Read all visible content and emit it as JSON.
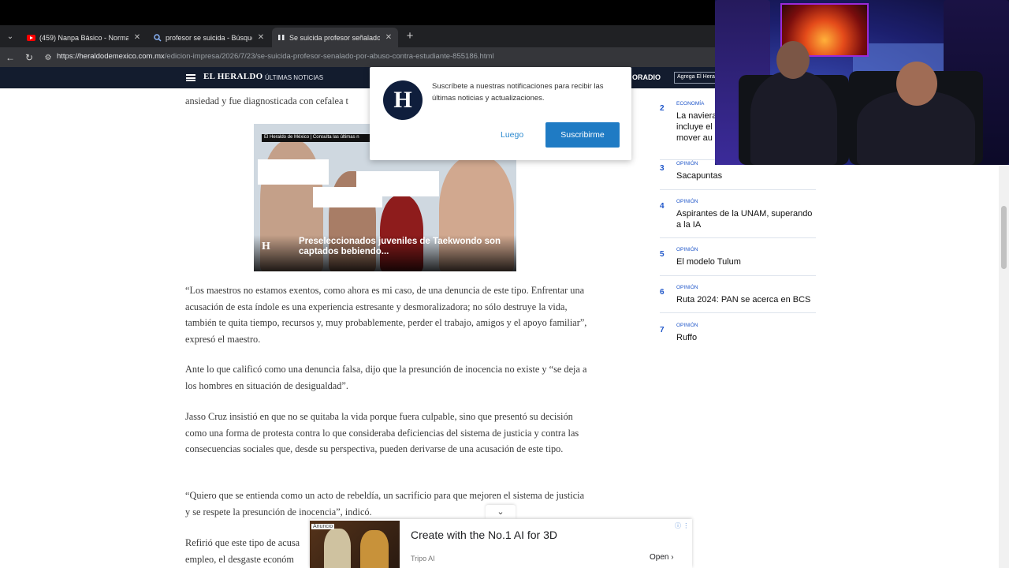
{
  "browser": {
    "tabs": [
      {
        "label": "(459) Nanpa Básico - Normal (Vi...",
        "favicon": "youtube-icon",
        "active": false
      },
      {
        "label": "profesor se suicida - Búsqueda",
        "favicon": "search-icon",
        "active": false
      },
      {
        "label": "Se suicida profesor señalado por a...",
        "favicon": "pause-icon",
        "active": true
      }
    ],
    "new_tab": "+",
    "url_host": "https://heraldodemexico.com.mx",
    "url_path": "/edicion-impresa/2026/7/23/se-suicida-profesor-senalado-por-abuso-contra-estudiante-855186.html"
  },
  "site_header": {
    "logo": "EL HERALDO",
    "ultimas": "ÚLTIMAS NOTICIAS",
    "radio": "ORADIO",
    "agrega": "Agrega El Hera"
  },
  "article": {
    "fragment_top": "ansiedad y fue diagnosticada con cefalea t",
    "paragraphs": [
      "“Los maestros no estamos exentos, como ahora es mi caso, de una denuncia de este tipo. Enfrentar una acusación de esta índole es una experiencia estresante y desmoralizadora; no sólo destruye la vida, también te quita tiempo, recursos y, muy probablemente, perder el trabajo, amigos y el apoyo familiar”, expresó el maestro.",
      "Ante lo que calificó como una denuncia falsa, dijo que la presunción de inocencia no existe y “se deja a los hombres en situación de desigualdad”.",
      "Jasso Cruz insistió en que no se quitaba la vida porque fuera culpable, sino que presentó su decisión como una forma de protesta contra lo que consideraba deficiencias del sistema de justicia y contra las consecuencias sociales que, desde su perspectiva, pueden derivarse de una acusación de este tipo.",
      "“Quiero que se entienda como un acto de rebeldía, un sacrificio para que mejoren el sistema de justicia y se respete la presunción de inocencia”, indicó.",
      "Refirió que este tipo de acusa empleo, el desgaste económ"
    ]
  },
  "video": {
    "topbar": "El Heraldo de México | Consulta las últimas n",
    "logo_letter": "H",
    "caption": "Preseleccionados juveniles de Taekwondo son captados bebiendo..."
  },
  "trending": [
    {
      "num": "2",
      "category": "ECONOMÍA",
      "title": "La naviera incluye el mover au"
    },
    {
      "num": "3",
      "category": "OPINIÓN",
      "title": "Sacapuntas"
    },
    {
      "num": "4",
      "category": "OPINIÓN",
      "title": "Aspirantes de la UNAM, superando a la IA"
    },
    {
      "num": "5",
      "category": "OPINIÓN",
      "title": "El modelo Tulum"
    },
    {
      "num": "6",
      "category": "OPINIÓN",
      "title": "Ruta 2024: PAN se acerca en BCS"
    },
    {
      "num": "7",
      "category": "OPINIÓN",
      "title": "Ruffo"
    }
  ],
  "notification": {
    "logo_letter": "H",
    "message": "Suscríbete a nuestras notificaciones para recibir las últimas noticias y actualizaciones.",
    "later": "Luego",
    "subscribe": "Suscribirme"
  },
  "ad": {
    "badge": "Anuncio",
    "title": "Create with the No.1 AI for 3D",
    "source": "Tripo AI",
    "open": "Open",
    "collapse": "⌄"
  },
  "colors": {
    "accent_blue": "#1f56c9",
    "subscribe_button": "#1f7bc4",
    "header_bg": "#131c2e"
  }
}
